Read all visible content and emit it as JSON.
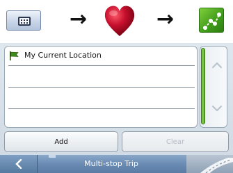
{
  "instruction_strip": {
    "steps": [
      "menu-button",
      "heart",
      "multi-stop-route"
    ],
    "arrow_glyph": "→"
  },
  "list": {
    "items": [
      {
        "icon": "flag-icon",
        "label": "My Current Location"
      },
      {
        "label": ""
      },
      {
        "label": ""
      },
      {
        "label": ""
      }
    ]
  },
  "buttons": {
    "add_label": "Add",
    "clear_label": "Clear"
  },
  "bottom_bar": {
    "title": "Multi-stop Trip"
  },
  "colors": {
    "accent_green": "#4f9a22",
    "bar_blue": "#6a8bb3",
    "heart_red": "#c8102e"
  }
}
